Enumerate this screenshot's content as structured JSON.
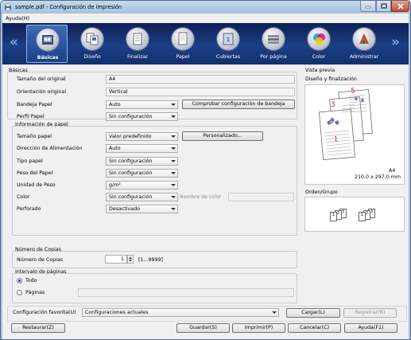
{
  "window": {
    "title": "sample.pdf - Configuración de impresión"
  },
  "menu": {
    "help": "Ayuda(H)"
  },
  "tabs": [
    {
      "id": "basicas",
      "label": "Básicas",
      "icon": "basic-settings-icon",
      "selected": true
    },
    {
      "id": "diseno",
      "label": "Diseño",
      "icon": "layout-icon",
      "selected": false
    },
    {
      "id": "finalizar",
      "label": "Finalizar",
      "icon": "finishing-icon",
      "selected": false
    },
    {
      "id": "papel",
      "label": "Papel",
      "icon": "paper-icon",
      "selected": false
    },
    {
      "id": "cubiertas",
      "label": "Cubiertas",
      "icon": "cover-icon",
      "selected": false
    },
    {
      "id": "por_pagina",
      "label": "Por página",
      "icon": "per-page-icon",
      "selected": false
    },
    {
      "id": "color",
      "label": "Color",
      "icon": "color-icon",
      "selected": false
    },
    {
      "id": "administrar",
      "label": "Administrar",
      "icon": "manage-icon",
      "selected": false
    }
  ],
  "basic": {
    "group_label": "Básicas",
    "original_size_label": "Tamaño del original",
    "original_size_value": "A4",
    "original_orientation_label": "Orientación original",
    "original_orientation_value": "Vertical",
    "paper_tray_label": "Bandeja Papel",
    "paper_tray_value": "Auto",
    "check_tray_button": "Comprobar configuración de bandeja",
    "paper_profile_label": "Perfil Papel",
    "paper_profile_value": "Sin configuración"
  },
  "paper_info": {
    "group_label": "Información de papel",
    "paper_size_label": "Tamaño papel",
    "paper_size_value": "Valor predefinido",
    "custom_button": "Personalizado...",
    "feed_direction_label": "Dirección de Alimentación",
    "feed_direction_value": "Auto",
    "paper_type_label": "Tipo papel",
    "paper_type_value": "Sin configuración",
    "paper_weight_label": "Peso del Papel",
    "paper_weight_value": "Sin configuración",
    "weight_unit_label": "Unidad de Peso",
    "weight_unit_value": "g/m²",
    "color_label": "Color",
    "color_value": "Sin configuración",
    "color_name_label": "Nombre de color",
    "color_name_value": "",
    "punched_label": "Perforado",
    "punched_value": "Desactivado"
  },
  "copies": {
    "group_label": "Número de Copias",
    "label": "Número de Copias",
    "value": "1",
    "range": "[1...9999]"
  },
  "page_range": {
    "group_label": "Intervalo de páginas",
    "all_label": "Todo",
    "pages_label": "Páginas",
    "pages_value": "",
    "selected": "all"
  },
  "preview": {
    "title": "Vista previa",
    "layout_label": "Diseño y finalización",
    "paper_size": "A4",
    "paper_dims": "210,0 x 297,0 mm",
    "page_numbers": [
      "5",
      "3",
      "1"
    ],
    "order_label": "Orden/Grupo",
    "order_left": [
      "1",
      "2",
      "3"
    ],
    "order_right": [
      "1",
      "2",
      "3"
    ]
  },
  "favorites": {
    "label": "Configuración favorita(U)",
    "value": "Configuraciones actuales",
    "load_button": "Cargar(L)",
    "register_button": "Registrar(R)"
  },
  "footer": {
    "restore": "Restaurar(Z)",
    "save": "Guardar(S)",
    "print": "Imprimir(P)",
    "cancel": "Cancelar(C)",
    "help": "Ayuda(F1)"
  },
  "colors": {
    "selected_tab": "#1a4188",
    "iconbar": "#12306c",
    "accent_red": "#d0202a"
  }
}
